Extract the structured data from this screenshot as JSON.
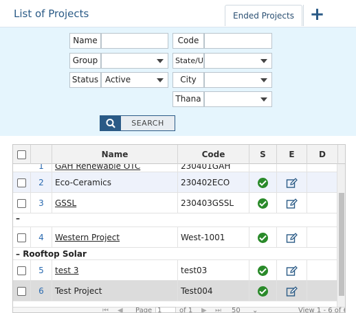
{
  "header": {
    "title": "List of Projects",
    "ended_tab": "Ended Projects",
    "add_label": "+"
  },
  "filters": {
    "name_label": "Name",
    "name_value": "",
    "code_label": "Code",
    "code_value": "",
    "group_label": "Group",
    "group_value": "",
    "state_label": "State/UT",
    "state_value": "",
    "status_label": "Status",
    "status_value": "Active",
    "city_label": "City",
    "city_value": "",
    "thana_label": "Thana",
    "thana_value": "",
    "search_label": "SEARCH"
  },
  "grid": {
    "columns": [
      "Name",
      "Code",
      "S",
      "E",
      "D"
    ],
    "partial_row": {
      "num": "1",
      "name": "GAH Renewable OTC",
      "code": "230401GAH"
    },
    "rows_group1": [
      {
        "num": "2",
        "name": "Eco-Ceramics",
        "code": "230402ECO",
        "linked": false
      },
      {
        "num": "3",
        "name": "GSSL",
        "code": "230403GSSL",
        "linked": true
      }
    ],
    "group_empty_marker": "–",
    "rows_group2": [
      {
        "num": "4",
        "name": "Western Project",
        "code": "West-1001",
        "linked": true
      }
    ],
    "group3_label": "Rooftop Solar",
    "group3_marker": "–",
    "rows_group3": [
      {
        "num": "5",
        "name": "test 3",
        "code": "test03",
        "linked": true
      },
      {
        "num": "6",
        "name": "Test Project",
        "code": "Test004",
        "linked": false
      }
    ],
    "pager": {
      "page_label": "Page",
      "page_value": "1",
      "of_label": "of 1",
      "size": "50",
      "view_text": "View 1 - 6 of 6"
    }
  },
  "colors": {
    "accent": "#2a5a86",
    "panel_bg": "#e5f5fd",
    "ok_green": "#2a8a2a"
  }
}
